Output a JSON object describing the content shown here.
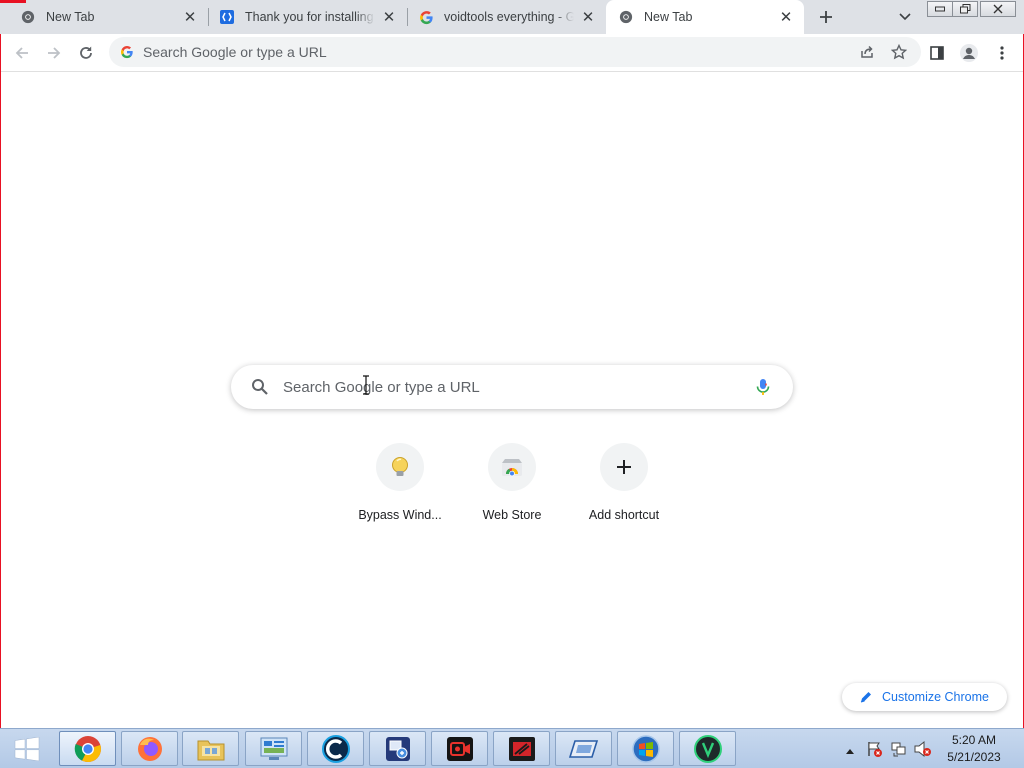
{
  "tabs": [
    {
      "title": "New Tab",
      "favicon": "chrome-icon",
      "active": false
    },
    {
      "title": "Thank you for installing AnyDesk",
      "favicon": "anydesk-icon",
      "active": false
    },
    {
      "title": "voidtools everything - Google Search",
      "favicon": "google-icon",
      "active": false
    },
    {
      "title": "New Tab",
      "favicon": "chrome-icon",
      "active": true
    }
  ],
  "omnibox": {
    "placeholder": "Search Google or type a URL",
    "value": ""
  },
  "ntp": {
    "search_placeholder": "Search Google or type a URL",
    "shortcuts": [
      {
        "label": "Bypass Wind...",
        "icon": "lightbulb-icon"
      },
      {
        "label": "Web Store",
        "icon": "web-store-icon"
      },
      {
        "label": "Add shortcut",
        "icon": "plus-icon"
      }
    ],
    "customize_label": "Customize Chrome"
  },
  "taskbar": {
    "apps": [
      "chrome-icon",
      "firefox-icon",
      "file-explorer-icon",
      "control-panel-icon",
      "ccleaner-icon",
      "remote-desktop-icon",
      "screen-recorder-icon",
      "media-icon",
      "drive-icon",
      "windows-media-icon",
      "shield-app-icon"
    ],
    "clock_time": "5:20 AM",
    "clock_date": "5/21/2023"
  },
  "colors": {
    "accent": "#1a73e8",
    "tabstrip": "#dee1e6",
    "frame_border": "#e81123"
  }
}
